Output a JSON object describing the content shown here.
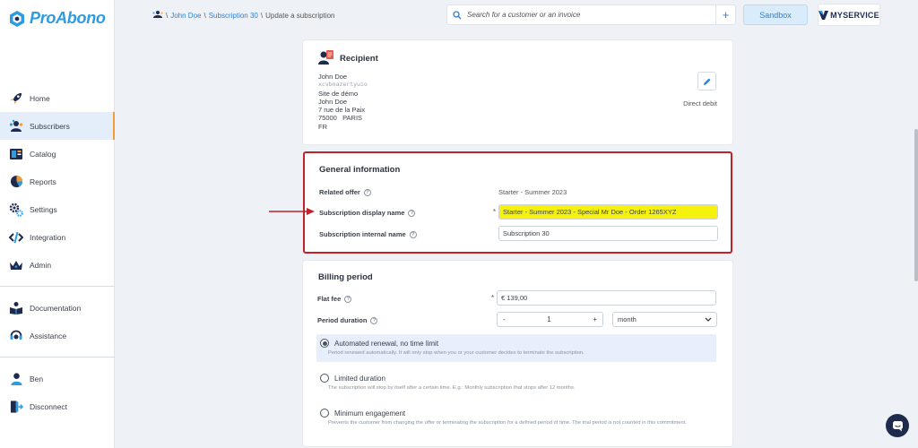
{
  "brand": {
    "logo_text": "ProAbono"
  },
  "nav": {
    "items": [
      {
        "label": "Home",
        "icon": "rocket-icon"
      },
      {
        "label": "Subscribers",
        "icon": "subscribers-icon",
        "active": true
      },
      {
        "label": "Catalog",
        "icon": "catalog-icon"
      },
      {
        "label": "Reports",
        "icon": "reports-icon"
      },
      {
        "label": "Settings",
        "icon": "settings-icon"
      },
      {
        "label": "Integration",
        "icon": "integration-icon"
      },
      {
        "label": "Admin",
        "icon": "crown-icon"
      }
    ],
    "help_items": [
      {
        "label": "Documentation",
        "icon": "documentation-icon"
      },
      {
        "label": "Assistance",
        "icon": "headset-icon"
      }
    ],
    "user_items": [
      {
        "label": "Ben",
        "icon": "user-icon"
      },
      {
        "label": "Disconnect",
        "icon": "logout-icon"
      }
    ]
  },
  "topbar": {
    "breadcrumb": {
      "sep": "\\",
      "customer": "John Doe",
      "subscription": "Subscription 30",
      "current": "Update a subscription"
    },
    "search_placeholder": "Search for a customer or an invoice",
    "plus_label": "+",
    "sandbox_label": "Sandbox",
    "brand_label": "MYSERVICE"
  },
  "recipient": {
    "title": "Recipient",
    "lines": [
      "John Doe",
      "xcvbnazertyuio",
      "Site de démo",
      "John Doe",
      "7 rue de la Paix",
      "75000   PARIS",
      "FR"
    ],
    "payment_method": "Direct debit"
  },
  "general": {
    "title": "General information",
    "related_offer_label": "Related offer",
    "related_offer_value": "Starter - Summer 2023",
    "display_name_label": "Subscription display name",
    "display_name_value": "Starter - Summer 2023 - Special Mr Doe - Order 1265XYZ",
    "internal_name_label": "Subscription internal name",
    "internal_name_value": "Subscription 30",
    "required_mark": "*"
  },
  "billing": {
    "title": "Billing period",
    "flat_fee_label": "Flat fee",
    "flat_fee_value": "€  139,00",
    "period_duration_label": "Period duration",
    "stepper_minus": "-",
    "stepper_value": "1",
    "stepper_plus": "+",
    "period_unit": "month",
    "options": [
      {
        "label": "Automated renewal, no time limit",
        "desc": "Period renewed automatically. It will only stop when you or your customer decides to terminate the subscription.",
        "selected": true
      },
      {
        "label": "Limited duration",
        "desc": "The subscription will stop by itself after a certain time. E.g.: Monthly subscription that stops after 12 months.",
        "selected": false
      },
      {
        "label": "Minimum engagement",
        "desc": "Prevents the customer from changing the offer or terminating the subscription for a defined period of time. The trial period is not counted in this commitment.",
        "selected": false
      }
    ]
  },
  "colors": {
    "accent": "#2f9be0",
    "highlight": "#f6f20d",
    "annotation_red": "#c0212b"
  }
}
